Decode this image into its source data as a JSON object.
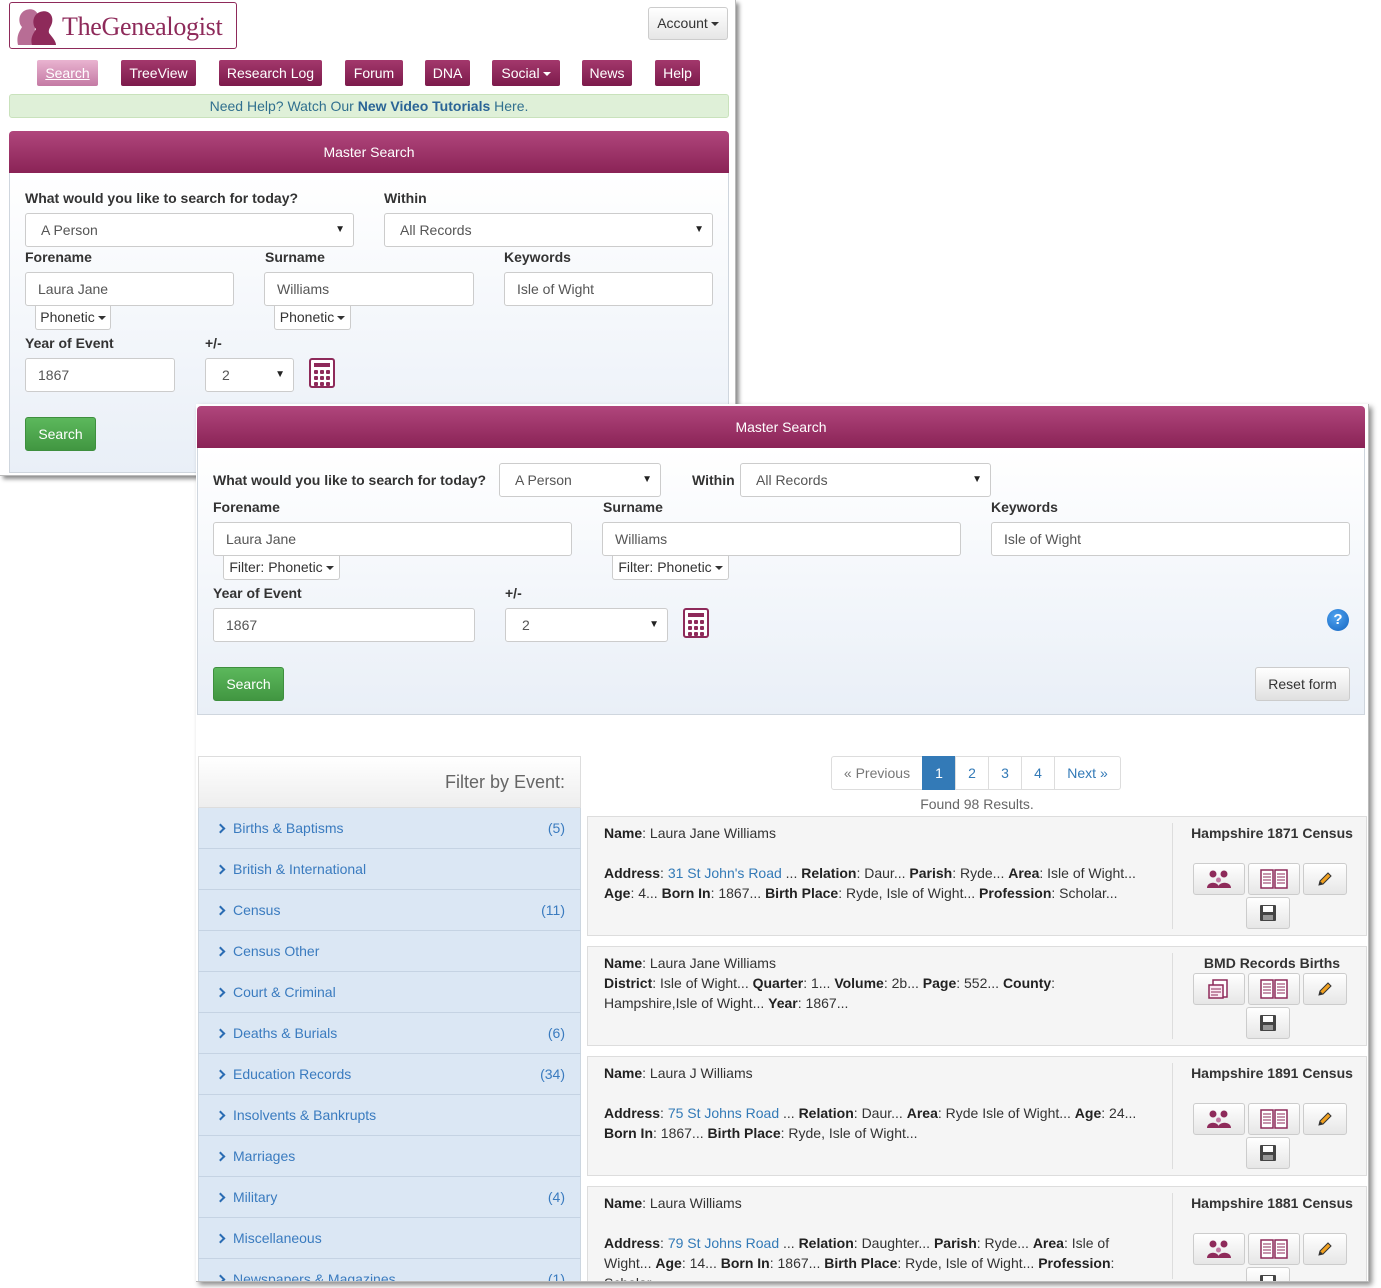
{
  "brand": {
    "name": "TheGenealogist"
  },
  "account": {
    "label": "Account"
  },
  "nav": {
    "items": [
      {
        "label": "Search",
        "active": true
      },
      {
        "label": "TreeView"
      },
      {
        "label": "Research Log"
      },
      {
        "label": "Forum"
      },
      {
        "label": "DNA"
      },
      {
        "label": "Social",
        "dropdown": true
      },
      {
        "label": "News"
      },
      {
        "label": "Help"
      }
    ]
  },
  "help_bar": {
    "prefix": "Need Help? Watch Our ",
    "link": "New Video Tutorials",
    "suffix": " Here."
  },
  "search_form": {
    "title": "Master Search",
    "question_label": "What would you like to search for today?",
    "question_value": "A Person",
    "within_label": "Within",
    "within_value": "All Records",
    "forename_label": "Forename",
    "forename_value": "Laura Jane",
    "surname_label": "Surname",
    "surname_value": "Williams",
    "keywords_label": "Keywords",
    "keywords_value": "Isle of Wight",
    "phonetic_small": "Phonetic",
    "phonetic_large": "Filter: Phonetic",
    "year_label": "Year of Event",
    "year_value": "1867",
    "plusminus_label": "+/-",
    "plusminus_value": "2",
    "search_button": "Search",
    "reset_button": "Reset form",
    "help_icon": "question-icon"
  },
  "filter": {
    "heading": "Filter by Event:",
    "items": [
      {
        "label": "Births & Baptisms",
        "count": "(5)"
      },
      {
        "label": "British & International",
        "count": ""
      },
      {
        "label": "Census",
        "count": "(11)"
      },
      {
        "label": "Census Other",
        "count": ""
      },
      {
        "label": "Court & Criminal",
        "count": ""
      },
      {
        "label": "Deaths & Burials",
        "count": "(6)"
      },
      {
        "label": "Education Records",
        "count": "(34)"
      },
      {
        "label": "Insolvents & Bankrupts",
        "count": ""
      },
      {
        "label": "Marriages",
        "count": ""
      },
      {
        "label": "Military",
        "count": "(4)"
      },
      {
        "label": "Miscellaneous",
        "count": ""
      },
      {
        "label": "Newspapers & Magazines",
        "count": "(1)"
      }
    ]
  },
  "pagination": {
    "prev": "« Previous",
    "pages": [
      "1",
      "2",
      "3",
      "4"
    ],
    "current": "1",
    "next": "Next »"
  },
  "results_summary": "Found 98 Results.",
  "results": [
    {
      "record_type": "Hampshire 1871 Census",
      "lines": [
        [
          {
            "b": "Name"
          },
          {
            "t": ": Laura Jane Williams"
          }
        ],
        [],
        [
          {
            "b": "Address"
          },
          {
            "t": ": "
          },
          {
            "a": "31 St John's Road"
          },
          {
            "t": " ... "
          },
          {
            "b": "Relation"
          },
          {
            "t": ": Daur... "
          },
          {
            "b": "Parish"
          },
          {
            "t": ": Ryde... "
          },
          {
            "b": "Area"
          },
          {
            "t": ": Isle of Wight..."
          }
        ],
        [
          {
            "b": "Age"
          },
          {
            "t": ": 4... "
          },
          {
            "b": "Born In"
          },
          {
            "t": ": 1867... "
          },
          {
            "b": "Birth Place"
          },
          {
            "t": ": Ryde, Isle of Wight... "
          },
          {
            "b": "Profession"
          },
          {
            "t": ": Scholar..."
          }
        ]
      ],
      "icons": [
        "family-icon",
        "transcript-icon",
        "pencil-icon",
        "save-icon"
      ]
    },
    {
      "record_type": "BMD Records Births",
      "lines": [
        [
          {
            "b": "Name"
          },
          {
            "t": ": Laura Jane Williams"
          }
        ],
        [
          {
            "b": "District"
          },
          {
            "t": ": Isle of Wight... "
          },
          {
            "b": "Quarter"
          },
          {
            "t": ": 1... "
          },
          {
            "b": "Volume"
          },
          {
            "t": ": 2b... "
          },
          {
            "b": "Page"
          },
          {
            "t": ": 552... "
          },
          {
            "b": "County"
          },
          {
            "t": ":"
          }
        ],
        [
          {
            "t": "Hampshire,Isle of Wight... "
          },
          {
            "b": "Year"
          },
          {
            "t": ": 1867..."
          }
        ]
      ],
      "icons": [
        "document-image-icon",
        "transcript-icon",
        "pencil-icon",
        "save-icon"
      ]
    },
    {
      "record_type": "Hampshire 1891 Census",
      "lines": [
        [
          {
            "b": "Name"
          },
          {
            "t": ": Laura J Williams"
          }
        ],
        [],
        [
          {
            "b": "Address"
          },
          {
            "t": ": "
          },
          {
            "a": "75 St Johns Road"
          },
          {
            "t": " ... "
          },
          {
            "b": "Relation"
          },
          {
            "t": ": Daur... "
          },
          {
            "b": "Area"
          },
          {
            "t": ": Ryde Isle of Wight... "
          },
          {
            "b": "Age"
          },
          {
            "t": ": 24..."
          }
        ],
        [
          {
            "b": "Born In"
          },
          {
            "t": ": 1867... "
          },
          {
            "b": "Birth Place"
          },
          {
            "t": ": Ryde, Isle of Wight..."
          }
        ]
      ],
      "icons": [
        "family-icon",
        "transcript-icon",
        "pencil-icon",
        "save-icon"
      ]
    },
    {
      "record_type": "Hampshire 1881 Census",
      "lines": [
        [
          {
            "b": "Name"
          },
          {
            "t": ": Laura Williams"
          }
        ],
        [],
        [
          {
            "b": "Address"
          },
          {
            "t": ": "
          },
          {
            "a": "79 St Johns Road"
          },
          {
            "t": " ... "
          },
          {
            "b": "Relation"
          },
          {
            "t": ": Daughter... "
          },
          {
            "b": "Parish"
          },
          {
            "t": ": Ryde... "
          },
          {
            "b": "Area"
          },
          {
            "t": ": Isle of"
          }
        ],
        [
          {
            "t": "Wight... "
          },
          {
            "b": "Age"
          },
          {
            "t": ": 14... "
          },
          {
            "b": "Born In"
          },
          {
            "t": ": 1867... "
          },
          {
            "b": "Birth Place"
          },
          {
            "t": ": Ryde, Isle of Wight... "
          },
          {
            "b": "Profession"
          },
          {
            "t": ":"
          }
        ],
        [
          {
            "t": "Scholar"
          }
        ]
      ],
      "icons": [
        "family-icon",
        "transcript-icon",
        "pencil-icon",
        "save-icon"
      ]
    }
  ],
  "colors": {
    "brand": "#8e2a5a",
    "link": "#337ab7",
    "success": "#5cb85c",
    "filter_bg": "#dbe7f4"
  }
}
